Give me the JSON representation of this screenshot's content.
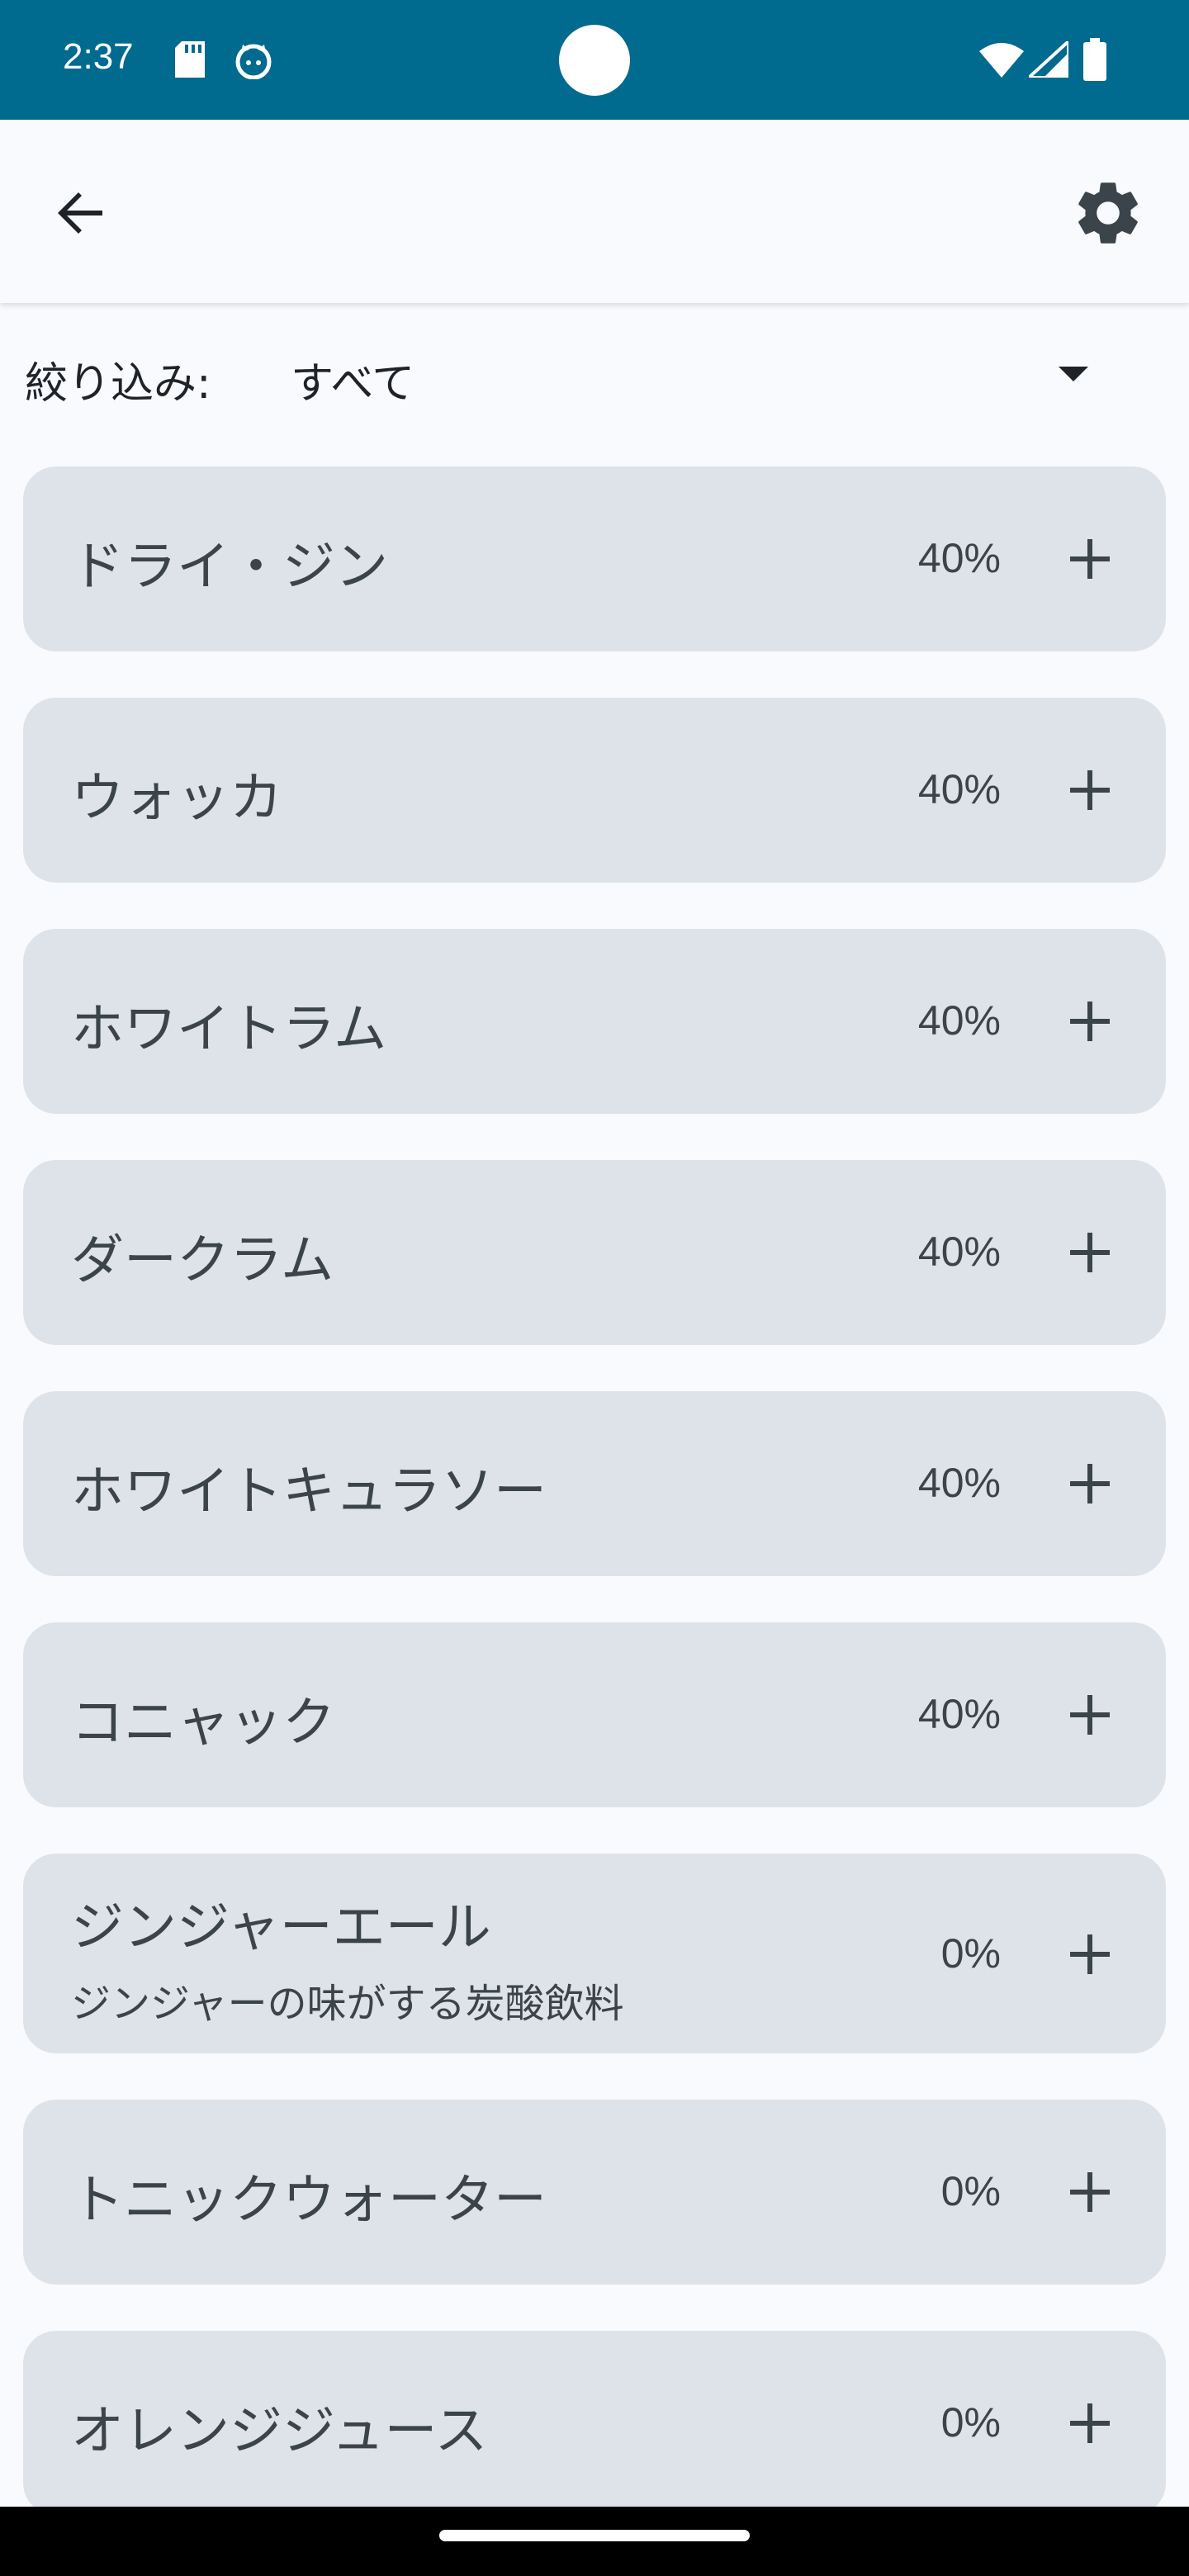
{
  "status_bar": {
    "time": "2:37",
    "background_color": "#006a8f"
  },
  "app_bar": {
    "back_icon": "arrow-left-icon",
    "settings_icon": "gear-icon"
  },
  "filter": {
    "label": "絞り込み:",
    "selected_value": "すべて",
    "dropdown_icon": "caret-down-icon"
  },
  "items": [
    {
      "name": "ドライ・ジン",
      "description": "",
      "abv": "40%"
    },
    {
      "name": "ウォッカ",
      "description": "",
      "abv": "40%"
    },
    {
      "name": "ホワイトラム",
      "description": "",
      "abv": "40%"
    },
    {
      "name": "ダークラム",
      "description": "",
      "abv": "40%"
    },
    {
      "name": "ホワイトキュラソー",
      "description": "",
      "abv": "40%"
    },
    {
      "name": "コニャック",
      "description": "",
      "abv": "40%"
    },
    {
      "name": "ジンジャーエール",
      "description": "ジンジャーの味がする炭酸飲料",
      "abv": "0%"
    },
    {
      "name": "トニックウォーター",
      "description": "",
      "abv": "0%"
    },
    {
      "name": "オレンジジュース",
      "description": "",
      "abv": "0%"
    }
  ],
  "colors": {
    "card_background": "#dde3e9",
    "page_background": "#f9fafd",
    "text": "#3b434b"
  }
}
